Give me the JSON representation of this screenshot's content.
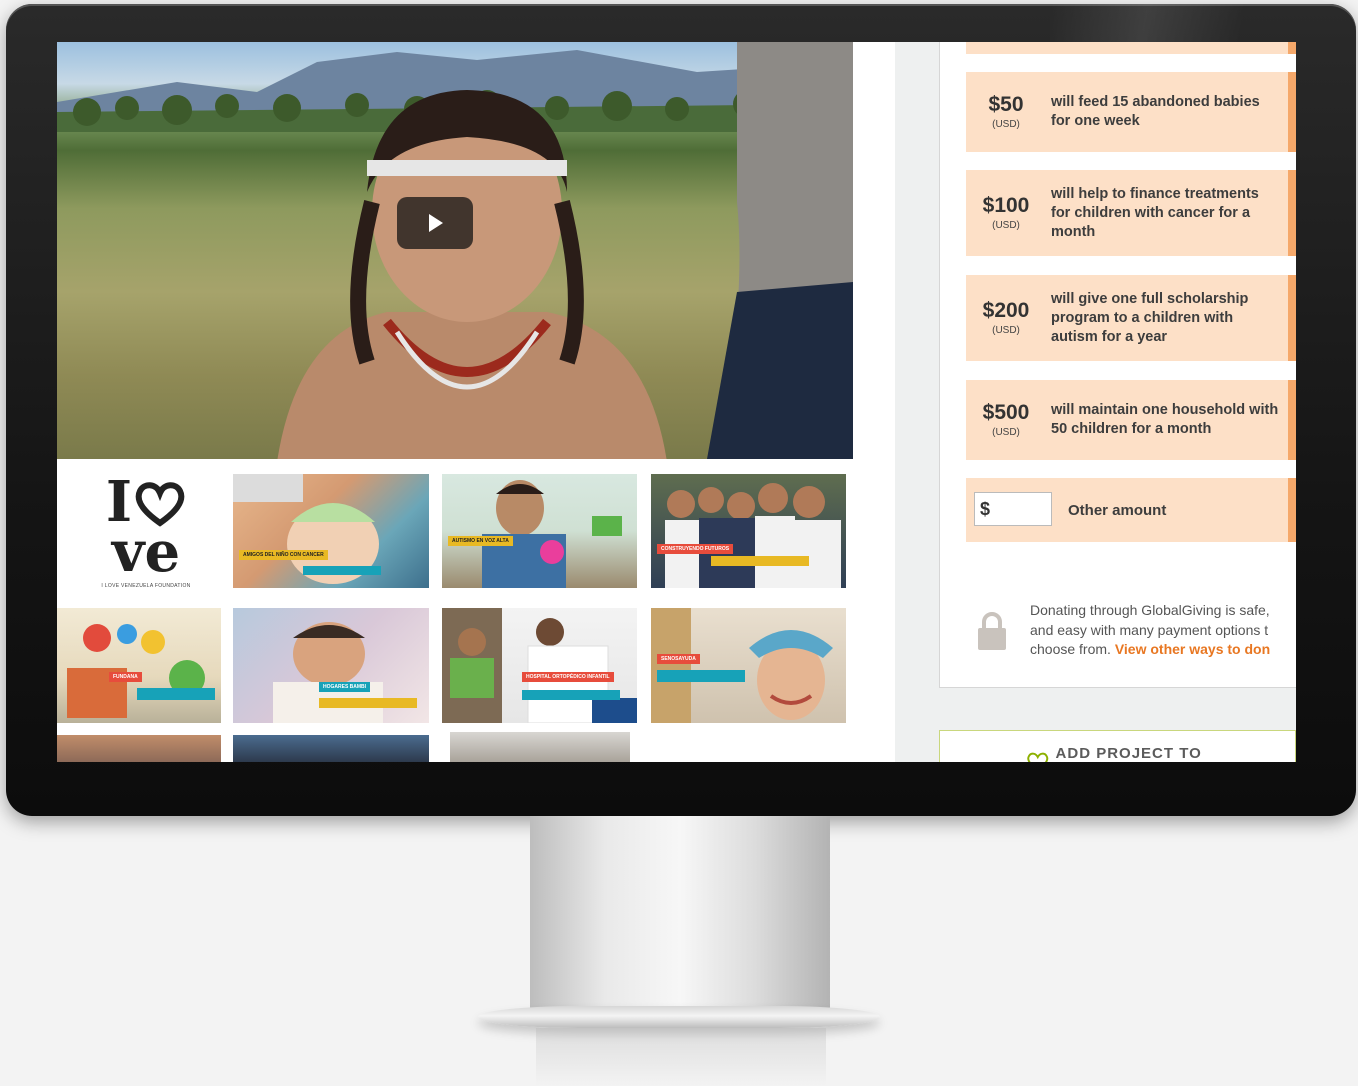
{
  "donation_options": [
    {
      "amount": "$50",
      "currency": "(USD)",
      "description": "will feed 15 abandoned babies for one week"
    },
    {
      "amount": "$100",
      "currency": "(USD)",
      "description": "will help to finance treatments for children with cancer for a month"
    },
    {
      "amount": "$200",
      "currency": "(USD)",
      "description": "will give one full scholarship program to a children with autism for a year"
    },
    {
      "amount": "$500",
      "currency": "(USD)",
      "description": "will maintain one household with 50 children for a month"
    }
  ],
  "other": {
    "currency_symbol": "$",
    "label": "Other amount"
  },
  "safe_giving": {
    "line1": "Donating through GlobalGiving is safe,",
    "line2": "and easy with many payment options t",
    "line3_prefix": "choose from. ",
    "link": "View other ways to don"
  },
  "favorites_label": "ADD PROJECT TO FAVORITES",
  "logo": {
    "top": "I",
    "bottom": "ve",
    "caption": "I LOVE VENEZUELA FOUNDATION"
  },
  "thumbs": {
    "t1": {
      "tag": "AMIGOS DEL NIÑO CON CANCER",
      "sub": ""
    },
    "t2": {
      "tag": "AUTISMO EN VOZ ALTA",
      "sub": ""
    },
    "t3": {
      "tag": "CONSTRUYENDO FUTUROS",
      "sub": ""
    },
    "t4": {
      "tag": "FUNDANA",
      "sub": ""
    },
    "t5": {
      "tag": "HOGARES BAMBI",
      "sub": ""
    },
    "t6": {
      "tag": "HOSPITAL ORTOPÉDICO INFANTIL",
      "sub": ""
    },
    "t7": {
      "tag": "SENOSAYUDA",
      "sub": ""
    }
  },
  "colors": {
    "option_bg": "#fde0c7",
    "option_edge": "#f5a86a",
    "link": "#e87722",
    "fav_border": "#c9d77d"
  }
}
